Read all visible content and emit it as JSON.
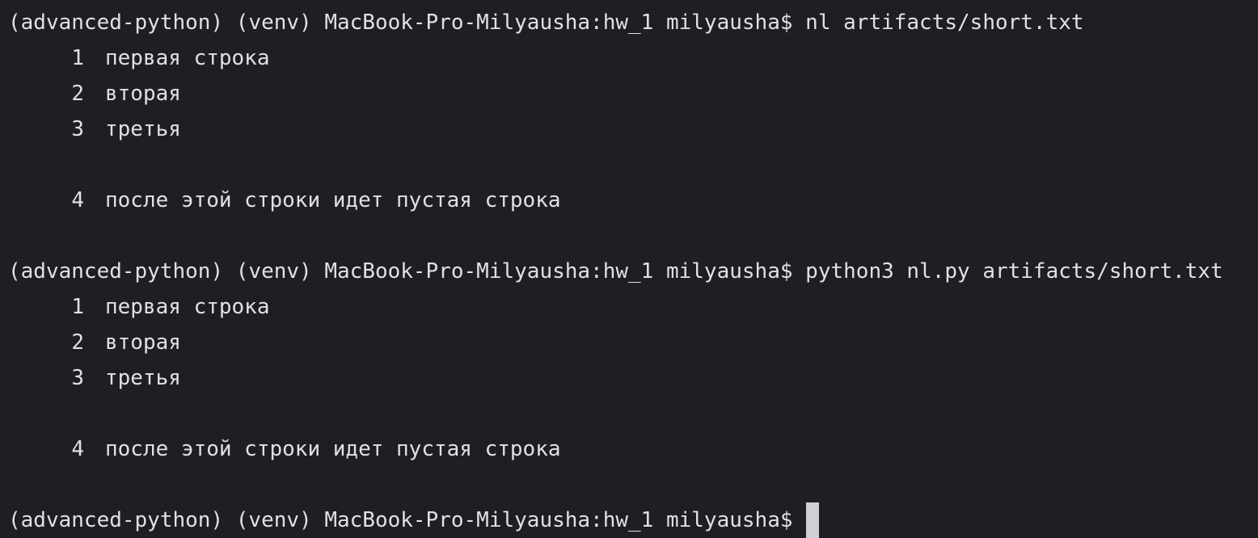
{
  "terminal": {
    "colors": {
      "background": "#1e1f22",
      "text": "#dfe1e5",
      "cursor": "#ced0d6"
    },
    "prompt": "(advanced-python) (venv) MacBook-Pro-Milyausha:hw_1 milyausha$",
    "blocks": [
      {
        "command": "nl artifacts/short.txt",
        "output": [
          {
            "num": "1",
            "text": "первая строка"
          },
          {
            "num": "2",
            "text": "вторая"
          },
          {
            "num": "3",
            "text": "третья"
          },
          {
            "num": "4",
            "text": "после этой строки идет пустая строка"
          }
        ]
      },
      {
        "command": "python3 nl.py artifacts/short.txt",
        "output": [
          {
            "num": "1",
            "text": "первая строка"
          },
          {
            "num": "2",
            "text": "вторая"
          },
          {
            "num": "3",
            "text": "третья"
          },
          {
            "num": "4",
            "text": "после этой строки идет пустая строка"
          }
        ]
      }
    ]
  }
}
